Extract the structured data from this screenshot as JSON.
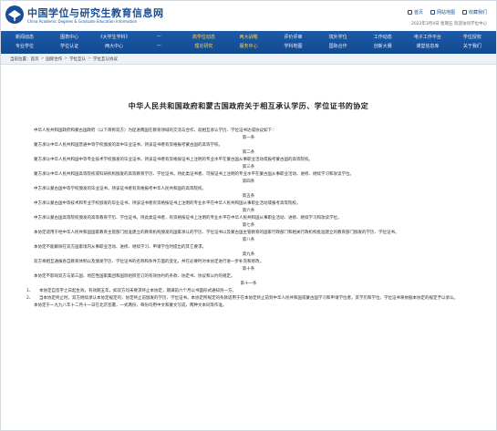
{
  "header": {
    "site_title": "中国学位与研究生教育信息网",
    "site_subtitle": "China Academic Degrees & Graduate Education Information",
    "links": [
      "首页",
      "网站地图",
      "收藏我们"
    ],
    "date_line": "2022年3月4日 星期五  欢迎访问学位中心"
  },
  "nav": {
    "row1": [
      "新闻动态",
      "图表中心",
      "《大学生学科》",
      "—",
      "高学位动态",
      "两大战略",
      "评价评审",
      "境外学位",
      "工作动态",
      "电子工作平台",
      "学位授权"
    ],
    "row2": [
      "专业学位",
      "学位认证",
      "两大中心",
      "—",
      "理论研究",
      "服务中心",
      "学科地图",
      "国际合作",
      "创新大赛",
      "课堂信息库",
      "关于我们"
    ],
    "highlight_indices": [
      4,
      5
    ]
  },
  "breadcrumb": {
    "label": "当前位置：",
    "items": [
      "首页",
      "国际合作",
      "学位互认",
      "学位互认协议"
    ]
  },
  "document": {
    "title": "中华人民共和国政府和蒙古国政府关于相互承认学历、学位证书的协定",
    "preamble": "中华人民共和国政府和蒙古国政府（以下简称双方）为促进两国在教育领域的交流与合作，就相互承认学历、学位证书达成协议如下：",
    "articles": [
      {
        "heading": "第一条",
        "text": "蒙方承认中华人民共和国普通中等学校颁发的高中毕业证书，持该证书者有资格报考蒙古国的高等学校。"
      },
      {
        "heading": "第二条",
        "text": "蒙方承认中华人民共和国中等专业技术学校颁发的毕业证书，持该证书者有资格按证书上注明的专业水平在蒙古国从事职业活动或报考蒙古国的高等院校。"
      },
      {
        "heading": "第三条",
        "text": "蒙方承认中华人民共和国高等院校或科研机构颁发的高等教育学历、学位证书。持此类证书者，可按证书上注明的专业水平在蒙古国从事职业活动、进修、继续学习和攻读学位。"
      },
      {
        "heading": "第四条",
        "text": "中方承认蒙古国中等学校颁发的毕业证书，持该证书者有资格报考中华人民共和国的高等院校。"
      },
      {
        "heading": "第五条",
        "text": "中方承认蒙古国中等技术和专业学校颁发的毕业证书，持该证书者有资格按证书上注明的专业水平在中华人民共和国从事职业活动或报考高等院校。"
      },
      {
        "heading": "第六条",
        "text": "中方承认蒙古国高等院校颁发的高等教育学历、学位证书。持此类证书者，有资格按证书上注明的专业水平在中华人民共和国从事职业活动、进修、继续学习和攻读学位。"
      },
      {
        "heading": "第七条",
        "text": "本协定适用于经中华人民共和国国家教育主管部门批准建立的教育机构颁发的国家承认的学历、学位证书以及蒙古国主管教育的国家行政部门和相关行政机构批准建立的教育部门颁发的学历、学位证书。"
      },
      {
        "heading": "第八条",
        "text": "本协定不能解除在双方国家境内从事职业活动、进修、继续学习、申请学位时提出的其它要求。"
      },
      {
        "heading": "第九条",
        "text": "双方将相互通报各自教育体制以及颁发学历、学位证书的名称和条件方面的变化，并在必要时对本协定进行进一步补充和修改。"
      },
      {
        "heading": "第十条",
        "text": "本协定不影响双方与第三国、地区性国家集团和国际组织签订的有效协约的条款、协定书、协议和公约的规定。"
      }
    ],
    "final_heading": "第十一条",
    "final_items": [
      {
        "num": "1、",
        "text": "本协定自签字之日起生效，有效期五年。如双方均未要求终止本协定，期满前六个月以书面形式通知另一方。"
      },
      {
        "num": "2、",
        "text": "当本协定终止时，双方继续承认本协定规定的，协定终止前颁发的学历、学位证书。本协定所规定的条款适用于在本协定终止前到中华人民共和国或蒙古国学习和申请学位者。其学历和学位，学位证书将依据本协定的规定予以承认。"
      }
    ],
    "signing": "本协定于一九九八年十二月十一日在北京签署，一式两份，每份均用中文和蒙文写成，两种文本同等作准。"
  },
  "colors": {
    "nav_bg": "#1d5aa8",
    "brand_blue": "#1a4f96",
    "nav_highlight": "#ffd24a"
  }
}
